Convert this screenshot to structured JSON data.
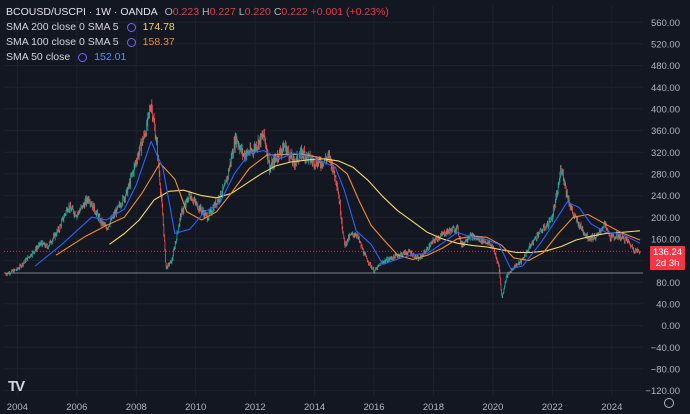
{
  "header": {
    "symbol": "BCOUSD/USCPI · 1W · OANDA",
    "ohlc": [
      {
        "k": "O",
        "v": "0.223"
      },
      {
        "k": "H",
        "v": "0.227"
      },
      {
        "k": "L",
        "v": "0.220"
      },
      {
        "k": "C",
        "v": "0.222"
      }
    ],
    "change": "+0.001 (+0.23%)"
  },
  "indicators": [
    {
      "name": "SMA 200 close 0 SMA 5",
      "value": "174.78",
      "color": "#f5d76e"
    },
    {
      "name": "SMA 100 close 0 SMA 5",
      "value": "158.37",
      "color": "#f28c28"
    },
    {
      "name": "SMA 50 close",
      "value": "152.01",
      "color": "#2962ff"
    }
  ],
  "price_label": {
    "value": "136.24",
    "countdown": "2d 3h"
  },
  "colors": {
    "up": "#26a69a",
    "down": "#ef5350",
    "bg": "#131722",
    "grid": "#1e222d"
  },
  "chart_data": {
    "type": "candlestick",
    "ylim": [
      -130,
      590
    ],
    "xlim": [
      2003.55,
      2025.05
    ],
    "yticks": [
      "560.00",
      "520.00",
      "480.00",
      "440.00",
      "400.00",
      "360.00",
      "320.00",
      "280.00",
      "240.00",
      "200.00",
      "160.00",
      "120.00",
      "80.00",
      "40.00",
      "0.00",
      "−40.00",
      "−80.00",
      "−120.00"
    ],
    "xticks": [
      {
        "label": "2004",
        "x": 2004.0
      },
      {
        "label": "2006",
        "x": 2006.0
      },
      {
        "label": "2008",
        "x": 2008.0
      },
      {
        "label": "2010",
        "x": 2010.0
      },
      {
        "label": "2012",
        "x": 2012.0
      },
      {
        "label": "2014",
        "x": 2014.0
      },
      {
        "label": "2016",
        "x": 2016.0
      },
      {
        "label": "2018",
        "x": 2018.0
      },
      {
        "label": "2020",
        "x": 2020.0
      },
      {
        "label": "2022",
        "x": 2022.0
      },
      {
        "label": "2024",
        "x": 2024.0
      }
    ],
    "reference_lines": [
      {
        "y": 137,
        "style": "dotted",
        "color": "#f23645"
      },
      {
        "y": 97,
        "style": "solid",
        "color": "#9598a1"
      }
    ],
    "price_series": [
      [
        2003.6,
        95
      ],
      [
        2004.0,
        104
      ],
      [
        2004.4,
        128
      ],
      [
        2004.8,
        152
      ],
      [
        2005.0,
        145
      ],
      [
        2005.4,
        178
      ],
      [
        2005.7,
        220
      ],
      [
        2006.0,
        205
      ],
      [
        2006.4,
        236
      ],
      [
        2006.8,
        192
      ],
      [
        2007.0,
        180
      ],
      [
        2007.4,
        218
      ],
      [
        2007.7,
        248
      ],
      [
        2008.0,
        305
      ],
      [
        2008.35,
        365
      ],
      [
        2008.5,
        412
      ],
      [
        2008.7,
        330
      ],
      [
        2008.9,
        195
      ],
      [
        2009.0,
        106
      ],
      [
        2009.2,
        120
      ],
      [
        2009.5,
        205
      ],
      [
        2009.8,
        242
      ],
      [
        2010.0,
        225
      ],
      [
        2010.4,
        200
      ],
      [
        2010.7,
        228
      ],
      [
        2011.0,
        258
      ],
      [
        2011.2,
        310
      ],
      [
        2011.35,
        348
      ],
      [
        2011.6,
        315
      ],
      [
        2011.9,
        322
      ],
      [
        2012.1,
        338
      ],
      [
        2012.3,
        352
      ],
      [
        2012.5,
        290
      ],
      [
        2012.8,
        318
      ],
      [
        2013.0,
        332
      ],
      [
        2013.3,
        300
      ],
      [
        2013.6,
        320
      ],
      [
        2013.9,
        305
      ],
      [
        2014.2,
        300
      ],
      [
        2014.5,
        312
      ],
      [
        2014.75,
        265
      ],
      [
        2014.9,
        200
      ],
      [
        2015.0,
        148
      ],
      [
        2015.2,
        166
      ],
      [
        2015.4,
        170
      ],
      [
        2015.7,
        128
      ],
      [
        2016.0,
        100
      ],
      [
        2016.3,
        118
      ],
      [
        2016.6,
        125
      ],
      [
        2016.9,
        132
      ],
      [
        2017.2,
        136
      ],
      [
        2017.5,
        122
      ],
      [
        2017.8,
        142
      ],
      [
        2018.0,
        156
      ],
      [
        2018.4,
        172
      ],
      [
        2018.8,
        180
      ],
      [
        2018.95,
        148
      ],
      [
        2019.2,
        166
      ],
      [
        2019.5,
        160
      ],
      [
        2019.8,
        154
      ],
      [
        2020.0,
        145
      ],
      [
        2020.2,
        110
      ],
      [
        2020.3,
        50
      ],
      [
        2020.45,
        90
      ],
      [
        2020.7,
        108
      ],
      [
        2020.95,
        118
      ],
      [
        2021.2,
        142
      ],
      [
        2021.5,
        168
      ],
      [
        2021.8,
        184
      ],
      [
        2022.0,
        200
      ],
      [
        2022.2,
        255
      ],
      [
        2022.3,
        295
      ],
      [
        2022.5,
        240
      ],
      [
        2022.7,
        205
      ],
      [
        2022.9,
        186
      ],
      [
        2023.2,
        162
      ],
      [
        2023.5,
        164
      ],
      [
        2023.75,
        188
      ],
      [
        2023.95,
        162
      ],
      [
        2024.2,
        166
      ],
      [
        2024.5,
        158
      ],
      [
        2024.75,
        140
      ],
      [
        2024.95,
        136
      ]
    ],
    "sma50": [
      [
        2004.6,
        110
      ],
      [
        2005.5,
        150
      ],
      [
        2006.5,
        200
      ],
      [
        2007.0,
        195
      ],
      [
        2007.6,
        215
      ],
      [
        2008.0,
        260
      ],
      [
        2008.5,
        340
      ],
      [
        2008.9,
        290
      ],
      [
        2009.3,
        170
      ],
      [
        2009.8,
        178
      ],
      [
        2010.3,
        210
      ],
      [
        2010.8,
        225
      ],
      [
        2011.3,
        280
      ],
      [
        2011.8,
        318
      ],
      [
        2012.3,
        323
      ],
      [
        2012.8,
        308
      ],
      [
        2013.3,
        318
      ],
      [
        2013.8,
        312
      ],
      [
        2014.3,
        302
      ],
      [
        2014.7,
        292
      ],
      [
        2015.0,
        250
      ],
      [
        2015.4,
        175
      ],
      [
        2015.9,
        150
      ],
      [
        2016.3,
        113
      ],
      [
        2016.8,
        123
      ],
      [
        2017.3,
        131
      ],
      [
        2017.8,
        133
      ],
      [
        2018.3,
        152
      ],
      [
        2018.8,
        172
      ],
      [
        2019.2,
        165
      ],
      [
        2019.7,
        160
      ],
      [
        2020.2,
        150
      ],
      [
        2020.6,
        105
      ],
      [
        2021.0,
        110
      ],
      [
        2021.6,
        152
      ],
      [
        2022.0,
        185
      ],
      [
        2022.5,
        228
      ],
      [
        2022.9,
        218
      ],
      [
        2023.3,
        188
      ],
      [
        2023.8,
        172
      ],
      [
        2024.3,
        170
      ],
      [
        2024.95,
        152
      ]
    ],
    "sma100": [
      [
        2005.3,
        130
      ],
      [
        2006.3,
        165
      ],
      [
        2007.0,
        185
      ],
      [
        2007.6,
        200
      ],
      [
        2008.2,
        245
      ],
      [
        2008.8,
        300
      ],
      [
        2009.3,
        270
      ],
      [
        2009.7,
        210
      ],
      [
        2010.2,
        195
      ],
      [
        2010.7,
        210
      ],
      [
        2011.2,
        245
      ],
      [
        2011.8,
        290
      ],
      [
        2012.4,
        315
      ],
      [
        2013.0,
        316
      ],
      [
        2013.6,
        316
      ],
      [
        2014.2,
        310
      ],
      [
        2014.7,
        298
      ],
      [
        2015.1,
        280
      ],
      [
        2015.5,
        230
      ],
      [
        2015.9,
        185
      ],
      [
        2016.3,
        160
      ],
      [
        2016.8,
        130
      ],
      [
        2017.3,
        122
      ],
      [
        2017.8,
        130
      ],
      [
        2018.3,
        143
      ],
      [
        2018.8,
        160
      ],
      [
        2019.3,
        165
      ],
      [
        2019.8,
        163
      ],
      [
        2020.3,
        148
      ],
      [
        2020.7,
        125
      ],
      [
        2021.2,
        120
      ],
      [
        2021.7,
        135
      ],
      [
        2022.2,
        170
      ],
      [
        2022.7,
        200
      ],
      [
        2023.2,
        205
      ],
      [
        2023.7,
        190
      ],
      [
        2024.3,
        172
      ],
      [
        2024.95,
        158
      ]
    ],
    "sma200": [
      [
        2007.1,
        150
      ],
      [
        2007.6,
        170
      ],
      [
        2008.1,
        195
      ],
      [
        2008.6,
        232
      ],
      [
        2009.1,
        248
      ],
      [
        2009.6,
        250
      ],
      [
        2010.2,
        240
      ],
      [
        2010.7,
        236
      ],
      [
        2011.2,
        244
      ],
      [
        2011.7,
        262
      ],
      [
        2012.2,
        280
      ],
      [
        2012.7,
        295
      ],
      [
        2013.2,
        302
      ],
      [
        2013.8,
        306
      ],
      [
        2014.3,
        308
      ],
      [
        2014.8,
        304
      ],
      [
        2015.3,
        292
      ],
      [
        2015.8,
        268
      ],
      [
        2016.3,
        238
      ],
      [
        2016.8,
        212
      ],
      [
        2017.3,
        192
      ],
      [
        2017.8,
        172
      ],
      [
        2018.3,
        160
      ],
      [
        2018.8,
        152
      ],
      [
        2019.3,
        148
      ],
      [
        2019.8,
        145
      ],
      [
        2020.3,
        140
      ],
      [
        2020.8,
        135
      ],
      [
        2021.3,
        135
      ],
      [
        2021.8,
        138
      ],
      [
        2022.3,
        146
      ],
      [
        2022.8,
        158
      ],
      [
        2023.3,
        165
      ],
      [
        2023.8,
        170
      ],
      [
        2024.3,
        172
      ],
      [
        2024.95,
        175
      ]
    ]
  }
}
